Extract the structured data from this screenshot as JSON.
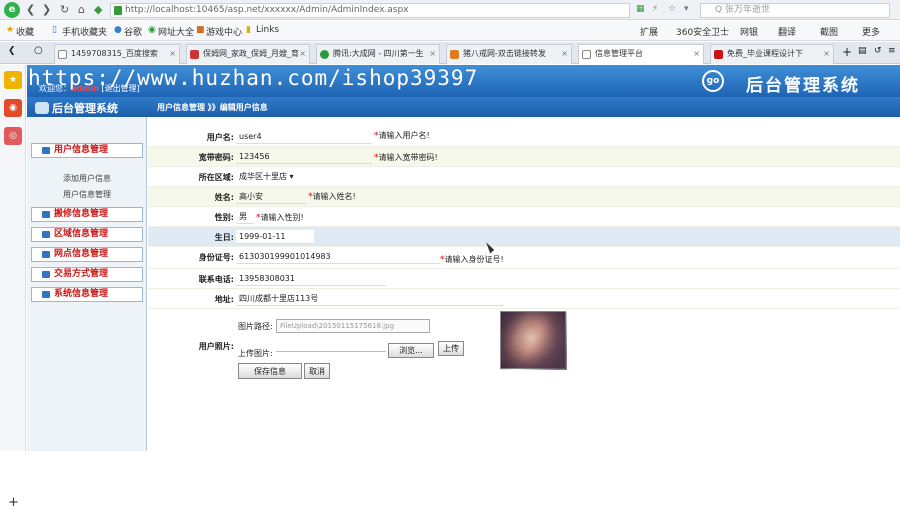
{
  "browser": {
    "url": "http://localhost:10465/asp.net/xxxxxx/Admin/AdminIndex.aspx",
    "search_placeholder": "Q 张万年逝世",
    "tools": "扩展",
    "bookmarks": [
      "收藏",
      "手机收藏夹",
      "谷歌",
      "网址大全",
      "游戏中心",
      "Links"
    ],
    "right_bookmarks": [
      "扩展",
      "360安全卫士",
      "网银",
      "翻译",
      "截图",
      "更多"
    ],
    "tabs": [
      {
        "label": "1459708315_百度搜索",
        "color": "#3366cc"
      },
      {
        "label": "保姆网_家政_保姆_月嫂_育",
        "color": "#cc3333"
      },
      {
        "label": "腾讯:大成网 - 四川第一生",
        "color": "#2a9a3a"
      },
      {
        "label": "猪八戒网-双击链接转发",
        "color": "#e07a1a"
      },
      {
        "label": "信息管理平台",
        "color": "#888888"
      },
      {
        "label": "免费_毕业课程设计下",
        "color": "#cc1111"
      }
    ]
  },
  "app": {
    "watermark": "https://www.huzhan.com/ishop39397",
    "brand": "后台管理系统",
    "brand_logo": "go",
    "welcome_prefix": "欢迎您：",
    "welcome_user": "admin",
    "welcome_logout": "[退出管理]",
    "sidebar_title": "后台管理系统",
    "breadcrumb": "用户信息管理 》》编辑用户信息"
  },
  "menu": {
    "user_mgmt": "用户信息管理",
    "add_user": "添加用户信息",
    "user_mgmt_sub": "用户信息管理",
    "items": [
      "搬修信息管理",
      "区域信息管理",
      "网点信息管理",
      "交易方式管理",
      "系统信息管理"
    ]
  },
  "form": {
    "username_label": "用户名:",
    "username_value": "user4",
    "username_hint": "请输入用户名!",
    "password_label": "宽带密码:",
    "password_value": "123456",
    "password_hint": "请输入宽带密码!",
    "region_label": "所在区域:",
    "region_value": "成华区十里店",
    "name_label": "姓名:",
    "name_value": "高小安",
    "name_hint": "请输入姓名!",
    "gender_label": "性别:",
    "gender_value": "男",
    "gender_hint": "请输入性别!",
    "birthday_label": "生日:",
    "birthday_value": "1999-01-11",
    "idcard_label": "身份证号:",
    "idcard_value": "613030199901014983",
    "idcard_hint": "请输入身份证号!",
    "phone_label": "联系电话:",
    "phone_value": "13958308031",
    "address_label": "地址:",
    "address_value": "四川成都十里店113号",
    "photo_label": "用户照片:",
    "photo_path_label": "图片路径:",
    "photo_path_value": "FileUpload\\20150115175618.jpg",
    "upload_label": "上传图片:",
    "browse_button": "浏览...",
    "upload_button": "上传",
    "save_button": "保存信息",
    "cancel_button": "取消"
  }
}
